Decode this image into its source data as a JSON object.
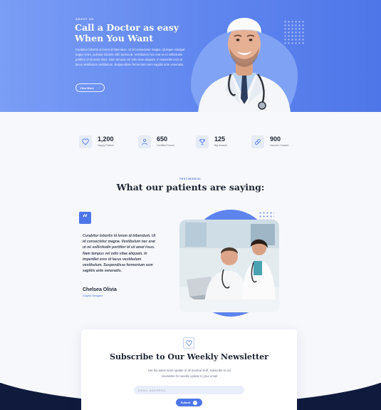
{
  "hero": {
    "eyebrow": "ABOUT US",
    "title": "Call a Doctor as easy When You Want",
    "text": "Curabitur lobortis id lorem id bibendum. Ut id consectetur magna. Quisque volutpat augue enim, pulvinar lobortis nibh lacinia at. Vestibulum nec erat ut mi sollicitudin porttitor id sit amet risus. Nam tempus vel odio vitae aliquam. In imperdiet eros id lacus vestibulum vestibulum. Suspendisse fermentum sem sagittis ante venenatis.",
    "button_label": "View More"
  },
  "stats": [
    {
      "icon": "heart-icon",
      "value": "1,200",
      "label": "Happy Patient"
    },
    {
      "icon": "doctor-icon",
      "value": "650",
      "label": "Certified Doctor"
    },
    {
      "icon": "trophy-icon",
      "value": "125",
      "label": "Big Awards"
    },
    {
      "icon": "pill-icon",
      "value": "900",
      "label": "Vaccine Created"
    }
  ],
  "testimonial": {
    "eyebrow": "TESTIMONIAL",
    "title": "What our patients are saying:",
    "quote_mark": "“",
    "text": "Curabitur lobortis id lorem id bibendum. Ut id consectetur magna. Vestibulum nec erat ut mi sollicitudin porttitor id sit amet risus. Nam tempus vel odio vitae aliquam. In imperdiet eros id lacus vestibulum vestibulum. Suspendisse fermentum sem sagittis ante venenatis.",
    "name": "Chelsea Olivia",
    "role": "Graphic Designer"
  },
  "newsletter": {
    "title": "Subscribe to Our Weekly Newsletter",
    "text": "Get the latest news update of all medical stuff, subscribe to our newsletter for weekly update to your email",
    "email_placeholder": "EMAIL ADDRESS",
    "submit_label": "Submit"
  },
  "colors": {
    "primary": "#4f76e8",
    "hero_light": "#7a9df5",
    "dark_navy": "#0f1a3c"
  }
}
